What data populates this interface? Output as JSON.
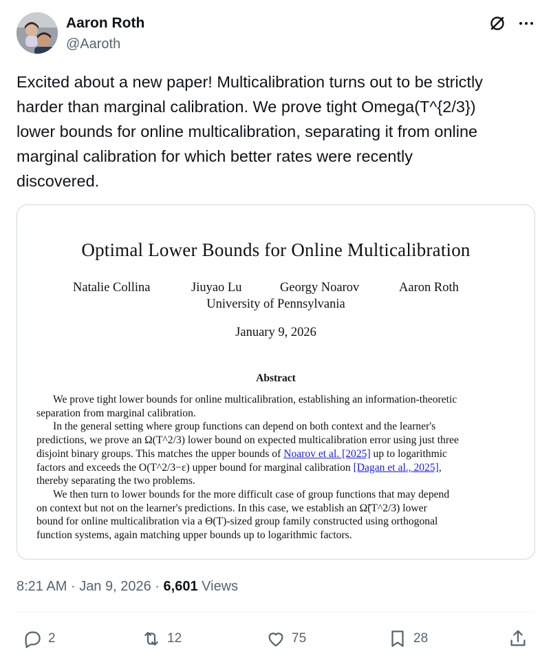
{
  "author": {
    "name": "Aaron Roth",
    "handle": "@Aaroth"
  },
  "tweet": {
    "text": "Excited about a new paper! Multicalibration turns out to be strictly\nharder than marginal calibration. We prove tight Omega(T^{2/3})\nlower bounds for online multicalibration, separating it from online\nmarginal calibration for which better rates were recently\ndiscovered."
  },
  "paper": {
    "title": "Optimal Lower Bounds for Online Multicalibration",
    "authors": [
      "Natalie Collina",
      "Jiuyao Lu",
      "Georgy Noarov",
      "Aaron Roth"
    ],
    "affiliation": "University of Pennsylvania",
    "date": "January 9, 2026",
    "abstract_heading": "Abstract",
    "abstract_lines": [
      "We prove tight lower bounds for online multicalibration, establishing an information-theoretic",
      "separation from marginal calibration.",
      "In the general setting where group functions can depend on both context and the learner's",
      "predictions, we prove an Ω(T^2/3) lower bound on expected multicalibration error using just three",
      "disjoint binary groups. This matches the upper bounds of ",
      "Noarov et al. [2025]",
      " up to logarithmic",
      "factors and exceeds the O(T^2/3−ε) upper bound for marginal calibration ",
      "[Dagan et al., 2025]",
      ",",
      "thereby separating the two problems.",
      "We then turn to lower bounds for the more difficult case of group functions that may depend",
      "on context but not on the learner's predictions. In this case, we establish an Ω̃(T^2/3) lower",
      "bound for online multicalibration via a Θ(T)-sized group family constructed using orthogonal",
      "function systems, again matching upper bounds up to logarithmic factors."
    ]
  },
  "meta": {
    "time": "8:21 AM",
    "date": "Jan 9, 2026",
    "views_count": "6,601",
    "views_label": "Views",
    "separator": "·"
  },
  "actions": {
    "replies": "2",
    "reposts": "12",
    "likes": "75",
    "bookmarks": "28"
  },
  "icons": [
    "grok-icon",
    "more-icon",
    "reply-icon",
    "repost-icon",
    "like-icon",
    "bookmark-icon",
    "share-icon"
  ]
}
